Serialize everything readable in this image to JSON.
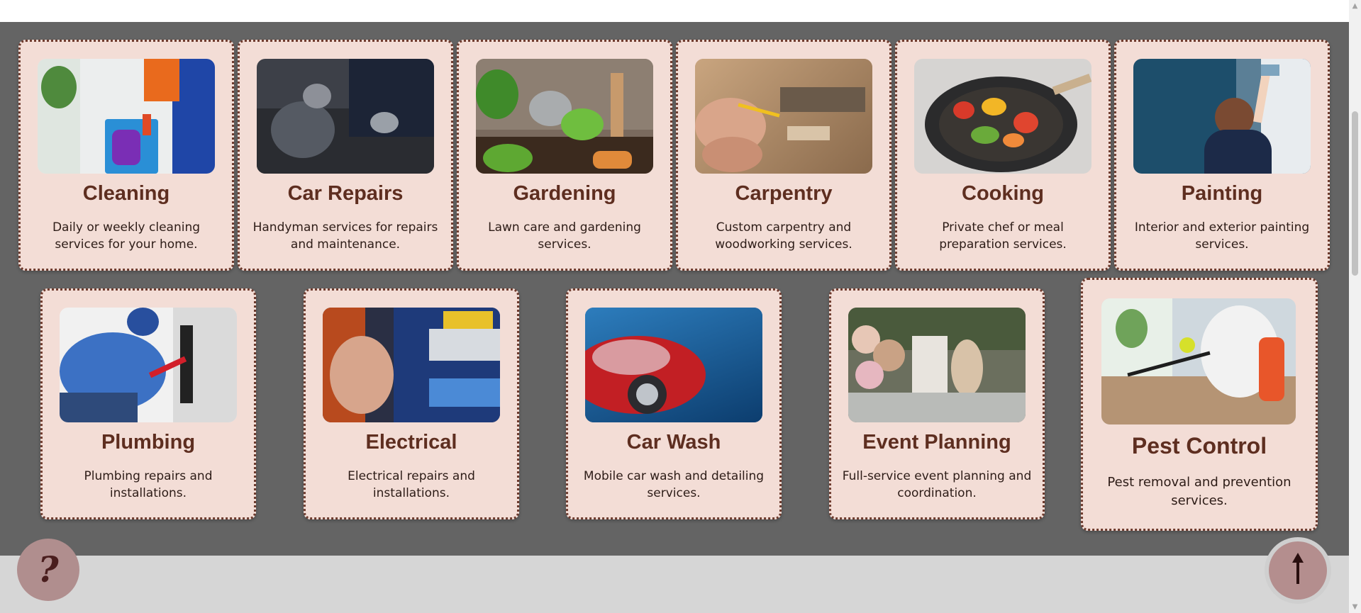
{
  "services": [
    {
      "title": "Cleaning",
      "description": "Daily or weekly cleaning services for your home.",
      "image_alt": "cleaning-photo"
    },
    {
      "title": "Car Repairs",
      "description": "Handyman services for repairs and maintenance.",
      "image_alt": "car-repair-photo"
    },
    {
      "title": "Gardening",
      "description": "Lawn care and gardening services.",
      "image_alt": "gardening-photo"
    },
    {
      "title": "Carpentry",
      "description": "Custom carpentry and woodworking services.",
      "image_alt": "carpentry-photo"
    },
    {
      "title": "Cooking",
      "description": "Private chef or meal preparation services.",
      "image_alt": "cooking-photo"
    },
    {
      "title": "Painting",
      "description": "Interior and exterior painting services.",
      "image_alt": "painting-photo"
    },
    {
      "title": "Plumbing",
      "description": "Plumbing repairs and installations.",
      "image_alt": "plumbing-photo"
    },
    {
      "title": "Electrical",
      "description": "Electrical repairs and installations.",
      "image_alt": "electrical-photo"
    },
    {
      "title": "Car Wash",
      "description": "Mobile car wash and detailing services.",
      "image_alt": "car-wash-photo"
    },
    {
      "title": "Event Planning",
      "description": "Full-service event planning and coordination.",
      "image_alt": "event-planning-photo"
    },
    {
      "title": "Pest Control",
      "description": "Pest removal and prevention services.",
      "image_alt": "pest-control-photo"
    }
  ],
  "help_button": {
    "label": "?",
    "icon": "question-mark-icon"
  },
  "back_to_top_button": {
    "icon": "arrow-up-icon"
  },
  "colors": {
    "band": "#646464",
    "card": "#f3ddd6",
    "card_border": "#6e3b2e",
    "title": "#5e2e20",
    "footer": "#d6d6d6",
    "button": "#b08e8e"
  }
}
